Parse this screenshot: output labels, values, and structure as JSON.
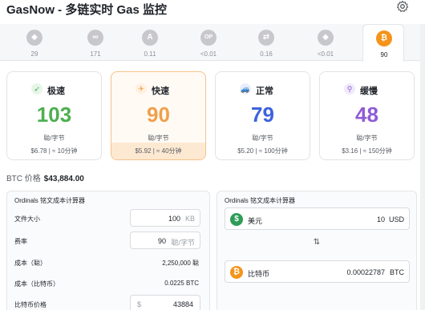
{
  "app": {
    "title": "GasNow - 多链实时 Gas 监控"
  },
  "tabs": [
    {
      "icon": "ethereum-icon",
      "glyph": "◆",
      "value": "29"
    },
    {
      "icon": "polygon-icon",
      "glyph": "∞",
      "value": "171"
    },
    {
      "icon": "arbitrum-icon",
      "glyph": "A",
      "value": "0.11"
    },
    {
      "icon": "optimism-icon",
      "glyph": "OP",
      "value": "<0.01"
    },
    {
      "icon": "bridge-icon",
      "glyph": "⇄",
      "value": "0.16"
    },
    {
      "icon": "ethereum-l2-icon",
      "glyph": "◆",
      "value": "<0.01"
    },
    {
      "icon": "bitcoin-icon",
      "glyph": "₿",
      "value": "90",
      "active": true
    }
  ],
  "cards": [
    {
      "name": "极速",
      "icon": "rocket-icon",
      "glyph": "➶",
      "color": "#4caf50",
      "badge_bg": "#e8f5e9",
      "gwei": "103",
      "unit": "聪/字节",
      "cost": "$6.78 | ≈ 10分钟"
    },
    {
      "name": "快速",
      "icon": "plane-icon",
      "glyph": "✈",
      "color": "#f0a04b",
      "badge_bg": "#fff1e0",
      "gwei": "90",
      "unit": "聪/字节",
      "cost": "$5.92 | ≈ 40分钟",
      "selected": true
    },
    {
      "name": "正常",
      "icon": "car-icon",
      "glyph": "🚙",
      "color": "#3d63dd",
      "badge_bg": "#e8eefc",
      "gwei": "79",
      "unit": "聪/字节",
      "cost": "$5.20 | ≈ 100分钟"
    },
    {
      "name": "缓慢",
      "icon": "bike-icon",
      "glyph": "⚲",
      "color": "#8e5bd6",
      "badge_bg": "#f1eafb",
      "gwei": "48",
      "unit": "聪/字节",
      "cost": "$3.16 | ≈ 150分钟"
    }
  ],
  "btc_price": {
    "label": "BTC 价格",
    "value": "$43,884.00"
  },
  "calculator": {
    "title": "Ordinals 铭文成本计算器",
    "file_size": {
      "label": "文件大小",
      "value": "100",
      "unit": "KB"
    },
    "fee_rate": {
      "label": "费率",
      "value": "90",
      "unit": "聪/字节"
    },
    "cost_sats": {
      "label": "成本（聪）",
      "value": "2,250,000 聪"
    },
    "cost_btc": {
      "label": "成本（比特币）",
      "value": "0.0225 BTC"
    },
    "btc_price": {
      "label": "比特币价格",
      "prefix": "$",
      "value": "43884"
    }
  },
  "converter": {
    "title": "Ordinals 铭文成本计算器",
    "usd": {
      "label": "美元",
      "value": "10",
      "currency": "USD",
      "color": "#2e9d57"
    },
    "btc": {
      "label": "比特币",
      "value": "0.00022787",
      "currency": "BTC",
      "color": "#f5931b"
    }
  }
}
